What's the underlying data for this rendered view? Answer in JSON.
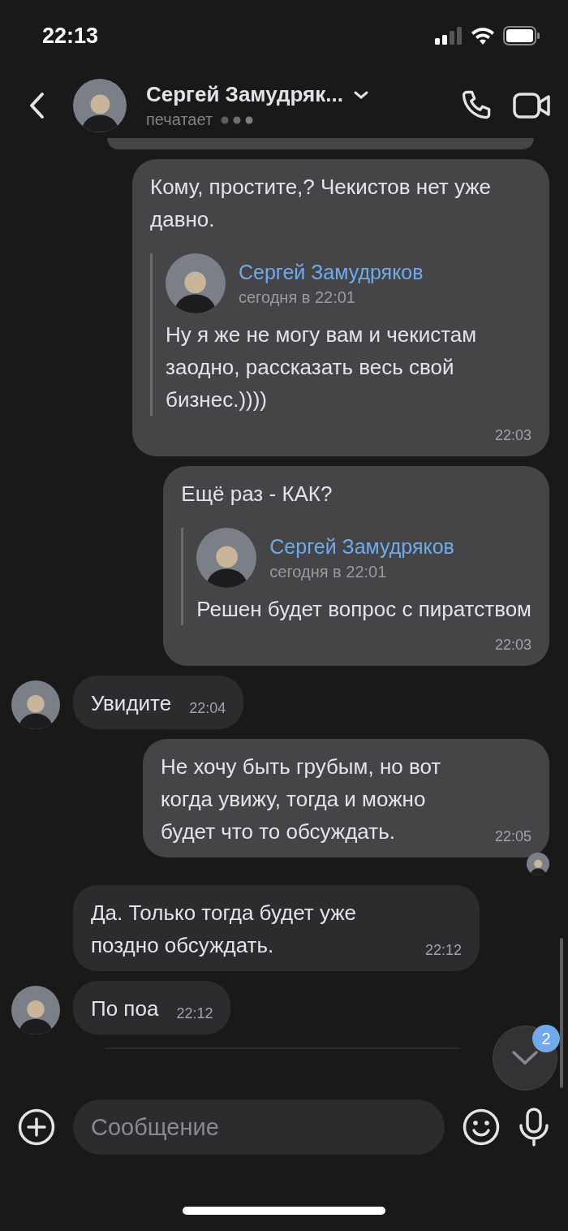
{
  "status_bar": {
    "time": "22:13"
  },
  "header": {
    "name": "Сергей Замудряк...",
    "status": "печатает"
  },
  "messages": [
    {
      "kind": "outgoing",
      "text": "Кому, простите,? Чекистов нет уже давно.",
      "time": "22:03",
      "reply": {
        "author": "Сергей Замудряков",
        "date": "сегодня в 22:01",
        "text": "Ну я же не могу вам и чекистам заодно, рассказать весь свой бизнес.))))"
      }
    },
    {
      "kind": "outgoing",
      "text": "Ещё раз - КАК?",
      "time": "22:03",
      "reply": {
        "author": "Сергей Замудряков",
        "date": "сегодня в 22:01",
        "text": "Решен будет вопрос с пиратством"
      }
    },
    {
      "kind": "incoming",
      "text": "Увидите",
      "time": "22:04",
      "avatar": true
    },
    {
      "kind": "outgoing",
      "text": "Не хочу быть грубым, но вот когда увижу, тогда и можно будет что то обсуждать.",
      "time": "22:05",
      "read": true
    },
    {
      "kind": "incoming",
      "text": "Да. Только тогда будет уже поздно обсуждать.",
      "time": "22:12",
      "avatar": false
    },
    {
      "kind": "incoming",
      "text": "По поа",
      "time": "22:12",
      "avatar": true
    }
  ],
  "scroll_button": {
    "badge": "2"
  },
  "composer": {
    "placeholder": "Сообщение"
  }
}
